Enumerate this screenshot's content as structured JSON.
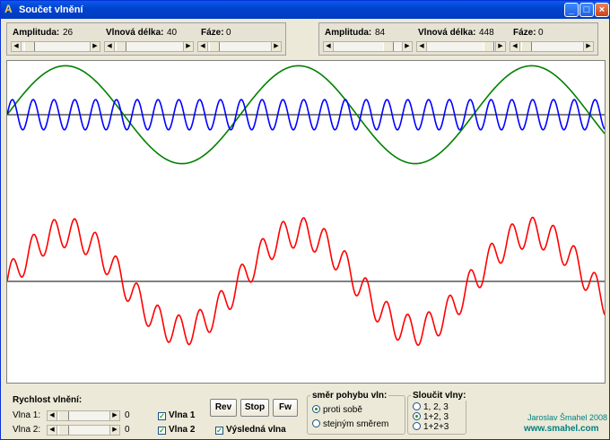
{
  "window": {
    "title": "Součet vlnění"
  },
  "wave_left": {
    "amplitude_label": "Amplituda:",
    "amplitude_value": "26",
    "wavelength_label": "Vlnová délka:",
    "wavelength_value": "40",
    "phase_label": "Fáze:",
    "phase_value": "0"
  },
  "wave_right": {
    "amplitude_label": "Amplituda:",
    "amplitude_value": "84",
    "wavelength_label": "Vlnová délka:",
    "wavelength_value": "448",
    "phase_label": "Fáze:",
    "phase_value": "0"
  },
  "bottom": {
    "speed_title": "Rychlost vlnění:",
    "wave1_label": "Vlna 1:",
    "wave1_value": "0",
    "wave2_label": "Vlna 2:",
    "wave2_value": "0",
    "cb_wave1": "Vlna 1",
    "cb_wave2": "Vlna 2",
    "cb_result": "Výsledná vlna",
    "btn_rev": "Rev",
    "btn_stop": "Stop",
    "btn_fw": "Fw",
    "direction_title": "směr pohybu vln:",
    "direction_opposite": "proti sobě",
    "direction_same": "stejným směrem",
    "merge_title": "Sloučit vlny:",
    "merge_opt1": "1, 2, 3",
    "merge_opt2": "1+2, 3",
    "merge_opt3": "1+2+3",
    "author": "Jaroslav Šmahel 2008",
    "url": "www.smahel.com"
  },
  "colors": {
    "wave1": "#0000ff",
    "wave2": "#008000",
    "result": "#ff0000",
    "axis": "#000000"
  },
  "icons": {
    "app": "app-icon",
    "minimize": "minimize-icon",
    "maximize": "maximize-icon",
    "close": "close-icon"
  }
}
